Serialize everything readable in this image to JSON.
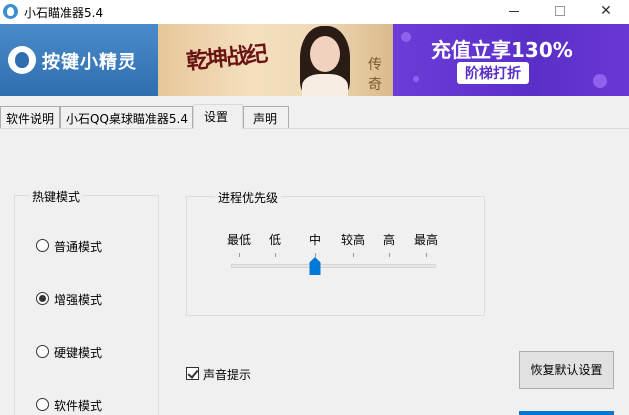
{
  "window": {
    "title": "小石瞄准器5.4",
    "minimize_icon": "minimize-icon",
    "maximize_icon": "maximize-icon",
    "close_glyph": "✕"
  },
  "banner": {
    "logo_text": "按键小精灵",
    "game_title": "乾坤战纪",
    "game_corner_text": "传奇",
    "promo_line1": "充值立享130%",
    "promo_line2": "阶梯打折",
    "colors": {
      "logo": "#3a7dbe",
      "promo": "#5f33cc",
      "game": "#eed9b7"
    }
  },
  "tabs": [
    {
      "label": "软件说明"
    },
    {
      "label": "小石QQ桌球瞄准器5.4"
    },
    {
      "label": "设置",
      "selected": true
    },
    {
      "label": "声明"
    }
  ],
  "hotkey_mode": {
    "title": "热键模式",
    "options": [
      {
        "label": "普通模式",
        "checked": false
      },
      {
        "label": "增强模式",
        "checked": true
      },
      {
        "label": "硬键模式",
        "checked": false
      },
      {
        "label": "软件模式",
        "checked": false
      }
    ]
  },
  "process_priority": {
    "title": "进程优先级",
    "levels": [
      "最低",
      "低",
      "中",
      "较高",
      "高",
      "最高"
    ],
    "selected_index": 2
  },
  "sound_hint": {
    "label": "声音提示",
    "checked": true
  },
  "reset_button": {
    "label": "恢复默认设置"
  },
  "accent_color": "#0078d7"
}
